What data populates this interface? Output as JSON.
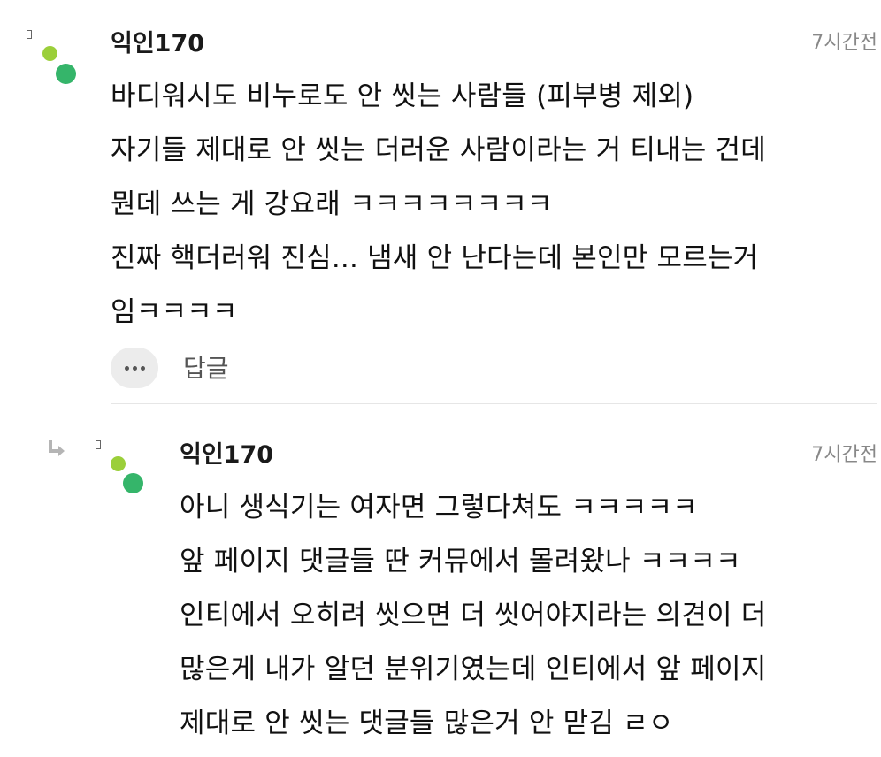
{
  "comments": [
    {
      "author": "익인170",
      "time": "7시간전",
      "lines": [
        "바디워시도 비누로도 안 씻는 사람들 (피부병 제외)",
        "자기들 제대로 안 씻는 더러운 사람이라는 거 티내는 건데",
        "뭔데 쓰는 게 강요래 ㅋㅋㅋㅋㅋㅋㅋㅋ",
        "진짜 핵더러워 진심... 냄새 안 난다는데 본인만 모르는거",
        "임ㅋㅋㅋㅋ"
      ],
      "reply_label": "답글"
    },
    {
      "author": "익인170",
      "time": "7시간전",
      "is_reply": true,
      "lines": [
        "아니 생식기는 여자면 그렇다쳐도 ㅋㅋㅋㅋㅋ",
        "앞 페이지 댓글들 딴 커뮤에서 몰려왔나 ㅋㅋㅋㅋ",
        "인티에서 오히려 씻으면 더 씻어야지라는 의견이 더",
        "많은게 내가 알던 분위기였는데 인티에서 앞 페이지",
        "제대로 안 씻는 댓글들 많은거 안 맏김 ㄹㅇ"
      ]
    }
  ],
  "icons": {
    "more": "ellipsis-icon",
    "reply_indicator": "reply-arrow-icon"
  },
  "colors": {
    "avatar_small": "#9bcf3a",
    "avatar_large": "#35b56a",
    "time": "#888888",
    "more_bg": "#ececec"
  }
}
